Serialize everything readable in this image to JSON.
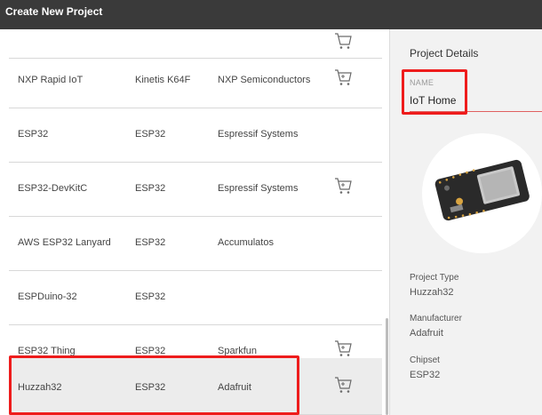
{
  "window": {
    "title": "Create New Project"
  },
  "rows": [
    {
      "name": "",
      "chip": "",
      "manufacturer": "",
      "cart": true
    },
    {
      "name": "NXP Rapid IoT",
      "chip": "Kinetis K64F",
      "manufacturer": "NXP Semiconductors",
      "cart": true
    },
    {
      "name": "ESP32",
      "chip": "ESP32",
      "manufacturer": "Espressif Systems",
      "cart": false
    },
    {
      "name": "ESP32-DevKitC",
      "chip": "ESP32",
      "manufacturer": "Espressif Systems",
      "cart": true
    },
    {
      "name": "AWS ESP32 Lanyard",
      "chip": "ESP32",
      "manufacturer": "Accumulatos",
      "cart": false
    },
    {
      "name": "ESPDuino-32",
      "chip": "ESP32",
      "manufacturer": "",
      "cart": false
    },
    {
      "name": "ESP32 Thing",
      "chip": "ESP32",
      "manufacturer": "Sparkfun",
      "cart": true
    },
    {
      "name": "Huzzah32",
      "chip": "ESP32",
      "manufacturer": "Adafruit",
      "cart": true,
      "selected": true
    }
  ],
  "details": {
    "title": "Project Details",
    "name_label": "NAME",
    "name_value": "IoT Home",
    "project_type_label": "Project Type",
    "project_type_value": "Huzzah32",
    "manufacturer_label": "Manufacturer",
    "manufacturer_value": "Adafruit",
    "chipset_label": "Chipset",
    "chipset_value": "ESP32",
    "image_icon": "board-image"
  },
  "icons": {
    "cart": "cart-icon"
  },
  "colors": {
    "highlight": "#ee1c1c",
    "titlebar": "#3a3a3a",
    "selected_row": "#ececec"
  }
}
